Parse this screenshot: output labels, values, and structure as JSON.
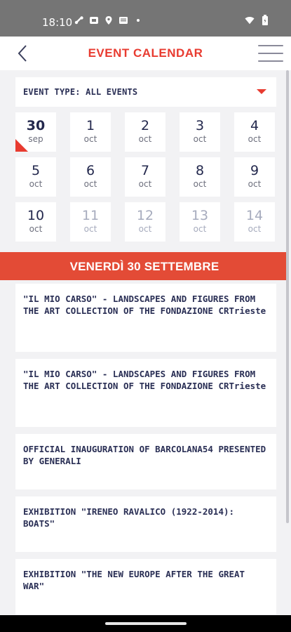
{
  "status_bar": {
    "time": "18:10"
  },
  "header": {
    "title": "EVENT CALENDAR"
  },
  "filter": {
    "label": "EVENT TYPE: ALL EVENTS"
  },
  "days": [
    {
      "num": "30",
      "mon": "sep",
      "selected": true,
      "disabled": false
    },
    {
      "num": "1",
      "mon": "oct",
      "selected": false,
      "disabled": false
    },
    {
      "num": "2",
      "mon": "oct",
      "selected": false,
      "disabled": false
    },
    {
      "num": "3",
      "mon": "oct",
      "selected": false,
      "disabled": false
    },
    {
      "num": "4",
      "mon": "oct",
      "selected": false,
      "disabled": false
    },
    {
      "num": "5",
      "mon": "oct",
      "selected": false,
      "disabled": false
    },
    {
      "num": "6",
      "mon": "oct",
      "selected": false,
      "disabled": false
    },
    {
      "num": "7",
      "mon": "oct",
      "selected": false,
      "disabled": false
    },
    {
      "num": "8",
      "mon": "oct",
      "selected": false,
      "disabled": false
    },
    {
      "num": "9",
      "mon": "oct",
      "selected": false,
      "disabled": false
    },
    {
      "num": "10",
      "mon": "oct",
      "selected": false,
      "disabled": false
    },
    {
      "num": "11",
      "mon": "oct",
      "selected": false,
      "disabled": true
    },
    {
      "num": "12",
      "mon": "oct",
      "selected": false,
      "disabled": true
    },
    {
      "num": "13",
      "mon": "oct",
      "selected": false,
      "disabled": true
    },
    {
      "num": "14",
      "mon": "oct",
      "selected": false,
      "disabled": true
    }
  ],
  "date_banner": "VENERDÌ 30 SETTEMBRE",
  "events": [
    {
      "title": "\"IL MIO CARSO\" - LANDSCAPES AND FIGURES FROM THE ART COLLECTION OF THE FONDAZIONE CRTrieste"
    },
    {
      "title": "\"IL MIO CARSO\" - LANDSCAPES AND FIGURES FROM THE ART COLLECTION OF THE FONDAZIONE CRTrieste"
    },
    {
      "title": "OFFICIAL INAUGURATION OF BARCOLANA54 PRESENTED BY GENERALI"
    },
    {
      "title": "EXHIBITION \"IRENEO RAVALICO (1922-2014): BOATS\""
    },
    {
      "title": "EXHIBITION \"THE NEW EUROPE AFTER THE GREAT WAR\""
    }
  ],
  "colors": {
    "accent": "#e83b30",
    "banner": "#e34b36",
    "text_dark": "#2a2f55",
    "background": "#f2f2f4"
  }
}
